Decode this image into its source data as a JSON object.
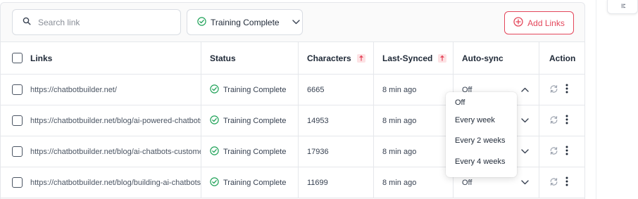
{
  "search": {
    "placeholder": "Search link"
  },
  "status_filter": {
    "label": "Training Complete"
  },
  "add_links": {
    "label": "Add Links"
  },
  "side_tab": {
    "label": "M"
  },
  "columns": {
    "links": "Links",
    "status": "Status",
    "characters": "Characters",
    "last_synced": "Last-Synced",
    "auto_sync": "Auto-sync",
    "action": "Action"
  },
  "rows": [
    {
      "url": "https://chatbotbuilder.net/",
      "status": "Training Complete",
      "characters": "6665",
      "last_synced": "8 min ago",
      "auto_sync": "Off"
    },
    {
      "url": "https://chatbotbuilder.net/blog/ai-powered-chatbots",
      "status": "Training Complete",
      "characters": "14953",
      "last_synced": "8 min ago",
      "auto_sync": ""
    },
    {
      "url": "https://chatbotbuilder.net/blog/ai-chatbots-customer",
      "status": "Training Complete",
      "characters": "17936",
      "last_synced": "8 min ago",
      "auto_sync": ""
    },
    {
      "url": "https://chatbotbuilder.net/blog/building-ai-chatbots",
      "status": "Training Complete",
      "characters": "11699",
      "last_synced": "8 min ago",
      "auto_sync": "Off"
    }
  ],
  "auto_sync_options": [
    "Off",
    "Every week",
    "Every 2 weeks",
    "Every 4 weeks"
  ],
  "colors": {
    "accent": "#e4475b",
    "success": "#22a35a"
  },
  "icons": {
    "search": "search-icon",
    "check_circle": "check-circle-icon",
    "chevron_down": "chevron-down-icon",
    "chevron_up": "chevron-up-icon",
    "plus_circle": "plus-circle-icon",
    "sort": "sort-icon",
    "sync": "sync-icon",
    "more": "more-vertical-icon"
  }
}
